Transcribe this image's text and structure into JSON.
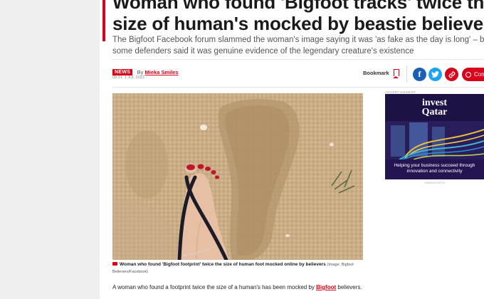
{
  "article": {
    "headline": "Woman who found 'Bigfoot tracks' twice the size of human's mocked by beastie believers",
    "standfirst": "The Bigfoot Facebook forum slammed the woman's image saying it was 'as fake as the day is long' – but some defenders said it was genuine evidence of the legendary creature's existence",
    "section_tag": "NEWS",
    "by_prefix": "By",
    "author": "Mieka Smiles",
    "timestamp": "09:31, 1 JUL 2023",
    "caption_bold": "Woman who found 'Bigfoot footprint' twice the size of human foot mocked online by believers",
    "caption_credit": "(Image: Bigfoot Believers/Facebook)",
    "body_start": "A woman who found a footprint twice the size of a human's has been mocked by",
    "body_link": "Bigfoot",
    "body_end": "believers."
  },
  "actions": {
    "bookmark_label": "Bookmark",
    "facebook_glyph": "f",
    "comments_label": "Com"
  },
  "icons": {
    "bookmark": "bookmark-icon",
    "facebook": "facebook-icon",
    "twitter": "twitter-icon",
    "link": "link-icon",
    "comments": "comments-icon",
    "camera": "camera-icon"
  },
  "ad": {
    "label": "ADVERTISEMENT",
    "brand_line1": "invest",
    "brand_line2": "Qatar",
    "tagline1": "Helping your business succeed through",
    "tagline2": "innovation and connectivity",
    "ad_id": "1984391125775"
  },
  "colors": {
    "brand_red": "#d9001b",
    "facebook_blue": "#1a5fb4",
    "twitter_blue": "#1da1f2"
  }
}
